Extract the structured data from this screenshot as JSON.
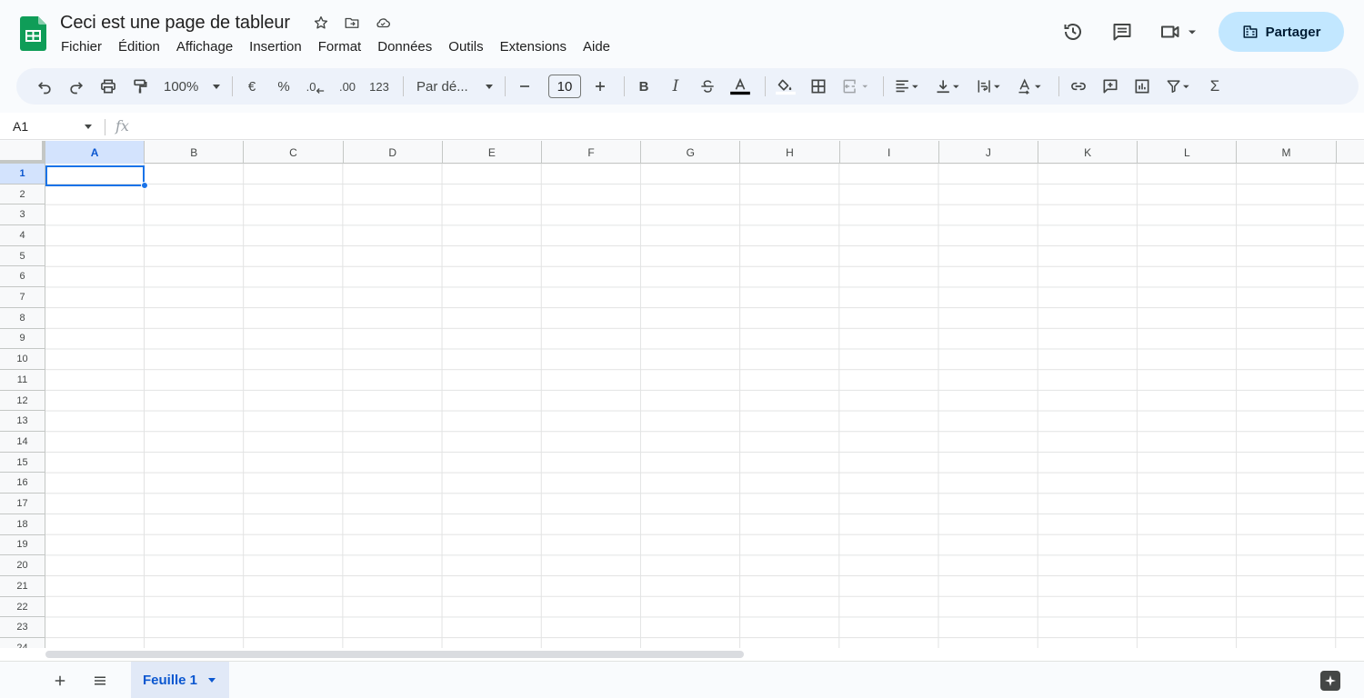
{
  "header": {
    "doc_title": "Ceci est une page de tableur",
    "menu": [
      "Fichier",
      "Édition",
      "Affichage",
      "Insertion",
      "Format",
      "Données",
      "Outils",
      "Extensions",
      "Aide"
    ],
    "share_label": "Partager"
  },
  "toolbar": {
    "zoom": "100%",
    "currency": "€",
    "percent": "%",
    "decrease_decimal": ".0",
    "increase_decimal": ".00",
    "number_format": "123",
    "font": "Par dé...",
    "font_size": "10",
    "bold": "B",
    "italic": "I",
    "sum": "Σ"
  },
  "formula_bar": {
    "name_box": "A1",
    "fx": "fx"
  },
  "grid": {
    "columns": [
      "A",
      "B",
      "C",
      "D",
      "E",
      "F",
      "G",
      "H",
      "I",
      "J",
      "K",
      "L",
      "M"
    ],
    "rows": [
      "1",
      "2",
      "3",
      "4",
      "5",
      "6",
      "7",
      "8",
      "9",
      "10",
      "11",
      "12",
      "13",
      "14",
      "15",
      "16",
      "17",
      "18",
      "19",
      "20",
      "21",
      "22",
      "23",
      "24"
    ],
    "selected_cell": "A1"
  },
  "sheets": {
    "tabs": [
      "Feuille 1"
    ]
  },
  "colors": {
    "accent": "#0b57d0",
    "share_bg": "#c2e7ff",
    "selection": "#1a73e8",
    "logo_green": "#0f9d58"
  }
}
